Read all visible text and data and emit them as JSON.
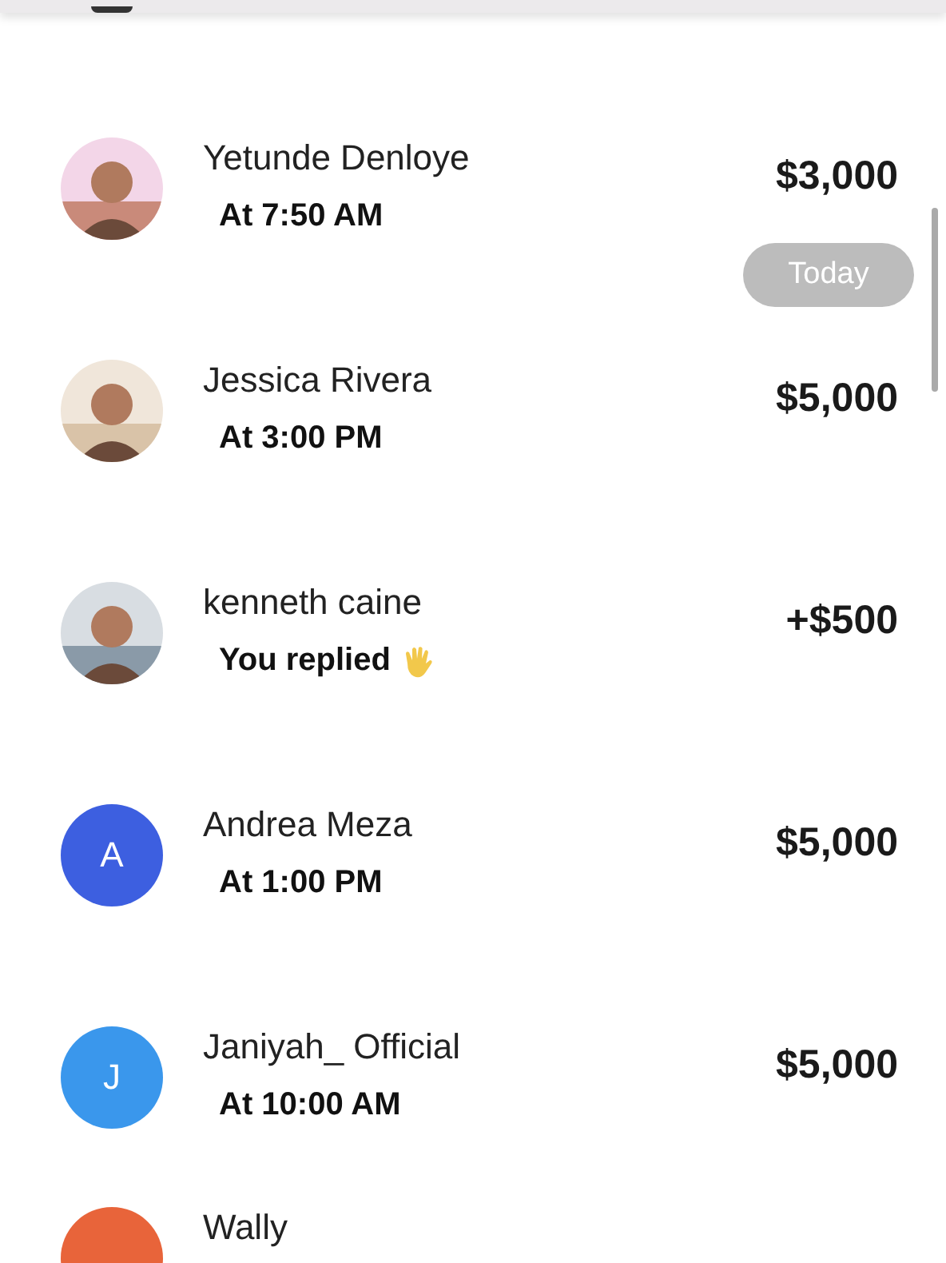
{
  "rows": [
    {
      "name": "Yetunde Denloye",
      "detail": "At 7:50 AM",
      "amount": "$3,000"
    },
    {
      "name": "Jessica Rivera",
      "detail": "At 3:00 PM",
      "amount": "$5,000"
    },
    {
      "name": "kenneth caine",
      "detail": "You replied",
      "reacted": true,
      "amount": "+$500"
    },
    {
      "name": "Andrea Meza",
      "detail": "At 1:00 PM",
      "amount": "$5,000",
      "avatar": {
        "kind": "letter",
        "letter": "A",
        "color": "#3d5fe0"
      }
    },
    {
      "name": "Janiyah_ Official",
      "detail": "At 10:00 AM",
      "amount": "$5,000",
      "avatar": {
        "kind": "letter",
        "letter": "J",
        "color": "#3a97ec"
      }
    },
    {
      "name": "Wally",
      "avatar": {
        "kind": "letter",
        "color": "#e8643a"
      }
    }
  ],
  "date_badge": "Today"
}
